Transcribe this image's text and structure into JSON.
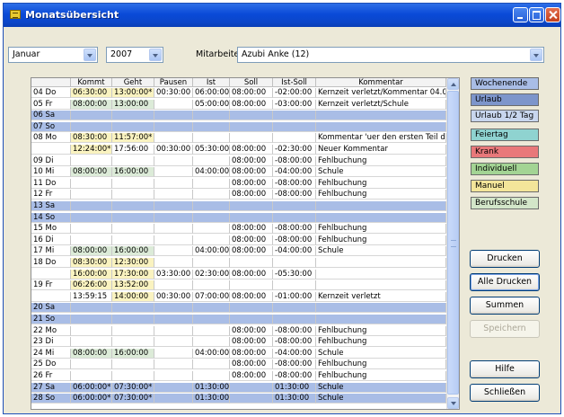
{
  "window": {
    "title": "Monatsübersicht"
  },
  "filters": {
    "month": "Januar",
    "year": "2007",
    "employee_label": "Mitarbeiter:",
    "employee": "Azubi Anke (12)"
  },
  "table": {
    "columns": [
      "",
      "Kommt",
      "Geht",
      "Pausen",
      "Ist",
      "Soll",
      "Ist-Soll",
      "Kommentar"
    ],
    "rows": [
      {
        "day": "04 Do",
        "kommt": "06:30:00",
        "geht": "13:00:00*",
        "pausen": "00:30:00",
        "ist": "06:00:00",
        "soll": "08:00:00",
        "diff": "-02:00:00",
        "kommentar": "Kernzeit verletzt/Kommentar 04.01",
        "type": "",
        "kc": "yellow",
        "gc": "yellow"
      },
      {
        "day": "05 Fr",
        "kommt": "08:00:00",
        "geht": "13:00:00",
        "pausen": "",
        "ist": "05:00:00",
        "soll": "08:00:00",
        "diff": "-03:00:00",
        "kommentar": "Kernzeit verletzt/Schule",
        "type": "",
        "kc": "green",
        "gc": "green"
      },
      {
        "day": "06 Sa",
        "kommt": "",
        "geht": "",
        "pausen": "",
        "ist": "",
        "soll": "",
        "diff": "",
        "kommentar": "",
        "type": "weekend",
        "kc": "",
        "gc": ""
      },
      {
        "day": "07 So",
        "kommt": "",
        "geht": "",
        "pausen": "",
        "ist": "",
        "soll": "",
        "diff": "",
        "kommentar": "",
        "type": "weekend",
        "kc": "",
        "gc": ""
      },
      {
        "day": "08 Mo",
        "kommt": "08:30:00",
        "geht": "11:57:00*",
        "pausen": "",
        "ist": "",
        "soll": "",
        "diff": "",
        "kommentar": "Kommentar 'uer den ersten Teil des",
        "type": "",
        "kc": "yellow",
        "gc": "yellow"
      },
      {
        "day": "",
        "kommt": "12:24:00*",
        "geht": "17:56:00",
        "pausen": "00:30:00",
        "ist": "05:30:00",
        "soll": "08:00:00",
        "diff": "-02:30:00",
        "kommentar": "Neuer Kommentar",
        "type": "",
        "kc": "yellow",
        "gc": ""
      },
      {
        "day": "09 Di",
        "kommt": "",
        "geht": "",
        "pausen": "",
        "ist": "",
        "soll": "08:00:00",
        "diff": "-08:00:00",
        "kommentar": "Fehlbuchung",
        "type": "",
        "kc": "",
        "gc": ""
      },
      {
        "day": "10 Mi",
        "kommt": "08:00:00",
        "geht": "16:00:00",
        "pausen": "",
        "ist": "04:00:00",
        "soll": "08:00:00",
        "diff": "-04:00:00",
        "kommentar": "Schule",
        "type": "",
        "kc": "green",
        "gc": "green"
      },
      {
        "day": "11 Do",
        "kommt": "",
        "geht": "",
        "pausen": "",
        "ist": "",
        "soll": "08:00:00",
        "diff": "-08:00:00",
        "kommentar": "Fehlbuchung",
        "type": "",
        "kc": "",
        "gc": ""
      },
      {
        "day": "12 Fr",
        "kommt": "",
        "geht": "",
        "pausen": "",
        "ist": "",
        "soll": "08:00:00",
        "diff": "-08:00:00",
        "kommentar": "Fehlbuchung",
        "type": "",
        "kc": "",
        "gc": ""
      },
      {
        "day": "13 Sa",
        "kommt": "",
        "geht": "",
        "pausen": "",
        "ist": "",
        "soll": "",
        "diff": "",
        "kommentar": "",
        "type": "weekend",
        "kc": "",
        "gc": ""
      },
      {
        "day": "14 So",
        "kommt": "",
        "geht": "",
        "pausen": "",
        "ist": "",
        "soll": "",
        "diff": "",
        "kommentar": "",
        "type": "weekend",
        "kc": "",
        "gc": ""
      },
      {
        "day": "15 Mo",
        "kommt": "",
        "geht": "",
        "pausen": "",
        "ist": "",
        "soll": "08:00:00",
        "diff": "-08:00:00",
        "kommentar": "Fehlbuchung",
        "type": "",
        "kc": "",
        "gc": ""
      },
      {
        "day": "16 Di",
        "kommt": "",
        "geht": "",
        "pausen": "",
        "ist": "",
        "soll": "08:00:00",
        "diff": "-08:00:00",
        "kommentar": "Fehlbuchung",
        "type": "",
        "kc": "",
        "gc": ""
      },
      {
        "day": "17 Mi",
        "kommt": "08:00:00",
        "geht": "16:00:00",
        "pausen": "",
        "ist": "04:00:00",
        "soll": "08:00:00",
        "diff": "-04:00:00",
        "kommentar": "Schule",
        "type": "",
        "kc": "green",
        "gc": "green"
      },
      {
        "day": "18 Do",
        "kommt": "08:30:00",
        "geht": "12:30:00",
        "pausen": "",
        "ist": "",
        "soll": "",
        "diff": "",
        "kommentar": "",
        "type": "",
        "kc": "yellow",
        "gc": "yellow"
      },
      {
        "day": "",
        "kommt": "16:00:00",
        "geht": "17:30:00",
        "pausen": "03:30:00",
        "ist": "02:30:00",
        "soll": "08:00:00",
        "diff": "-05:30:00",
        "kommentar": "",
        "type": "",
        "kc": "yellow",
        "gc": "yellow"
      },
      {
        "day": "19 Fr",
        "kommt": "06:26:00",
        "geht": "13:52:00",
        "pausen": "",
        "ist": "",
        "soll": "",
        "diff": "",
        "kommentar": "",
        "type": "",
        "kc": "yellow",
        "gc": "yellow"
      },
      {
        "day": "",
        "kommt": "13:59:15",
        "geht": "14:00:00",
        "pausen": "00:30:00",
        "ist": "07:00:00",
        "soll": "08:00:00",
        "diff": "-01:00:00",
        "kommentar": "Kernzeit verletzt",
        "type": "",
        "kc": "",
        "gc": "yellow"
      },
      {
        "day": "20 Sa",
        "kommt": "",
        "geht": "",
        "pausen": "",
        "ist": "",
        "soll": "",
        "diff": "",
        "kommentar": "",
        "type": "weekend",
        "kc": "",
        "gc": ""
      },
      {
        "day": "21 So",
        "kommt": "",
        "geht": "",
        "pausen": "",
        "ist": "",
        "soll": "",
        "diff": "",
        "kommentar": "",
        "type": "weekend",
        "kc": "",
        "gc": ""
      },
      {
        "day": "22 Mo",
        "kommt": "",
        "geht": "",
        "pausen": "",
        "ist": "",
        "soll": "08:00:00",
        "diff": "-08:00:00",
        "kommentar": "Fehlbuchung",
        "type": "",
        "kc": "",
        "gc": ""
      },
      {
        "day": "23 Di",
        "kommt": "",
        "geht": "",
        "pausen": "",
        "ist": "",
        "soll": "08:00:00",
        "diff": "-08:00:00",
        "kommentar": "Fehlbuchung",
        "type": "",
        "kc": "",
        "gc": ""
      },
      {
        "day": "24 Mi",
        "kommt": "08:00:00",
        "geht": "16:00:00",
        "pausen": "",
        "ist": "04:00:00",
        "soll": "08:00:00",
        "diff": "-04:00:00",
        "kommentar": "Schule",
        "type": "",
        "kc": "green",
        "gc": "green"
      },
      {
        "day": "25 Do",
        "kommt": "",
        "geht": "",
        "pausen": "",
        "ist": "",
        "soll": "08:00:00",
        "diff": "-08:00:00",
        "kommentar": "Fehlbuchung",
        "type": "",
        "kc": "",
        "gc": ""
      },
      {
        "day": "26 Fr",
        "kommt": "",
        "geht": "",
        "pausen": "",
        "ist": "",
        "soll": "08:00:00",
        "diff": "-08:00:00",
        "kommentar": "Fehlbuchung",
        "type": "",
        "kc": "",
        "gc": ""
      },
      {
        "day": "27 Sa",
        "kommt": "06:00:00*",
        "geht": "07:30:00*",
        "pausen": "",
        "ist": "01:30:00",
        "soll": "",
        "diff": "01:30:00",
        "kommentar": "Schule",
        "type": "weekend",
        "kc": "",
        "gc": ""
      },
      {
        "day": "28 So",
        "kommt": "06:00:00*",
        "geht": "07:30:00*",
        "pausen": "",
        "ist": "01:30:00",
        "soll": "",
        "diff": "01:30:00",
        "kommentar": "Schule",
        "type": "weekend",
        "kc": "",
        "gc": ""
      }
    ]
  },
  "legend": [
    {
      "label": "Wochenende",
      "color": "#a9bde6"
    },
    {
      "label": "Urlaub",
      "color": "#7d95cb"
    },
    {
      "label": "Urlaub 1/2 Tag",
      "color": "#c8d6ee"
    },
    {
      "label": "Feiertag",
      "color": "#8fd3d0"
    },
    {
      "label": "Krank",
      "color": "#e8787a"
    },
    {
      "label": "Individuell",
      "color": "#a3d494"
    },
    {
      "label": "Manuel",
      "color": "#f3e59a"
    },
    {
      "label": "Berufsschule",
      "color": "#d3e6c9"
    }
  ],
  "actions": {
    "print": "Drucken",
    "print_all": "Alle Drucken",
    "sums": "Summen",
    "save": "Speichern",
    "help": "Hilfe",
    "close": "Schließen"
  }
}
